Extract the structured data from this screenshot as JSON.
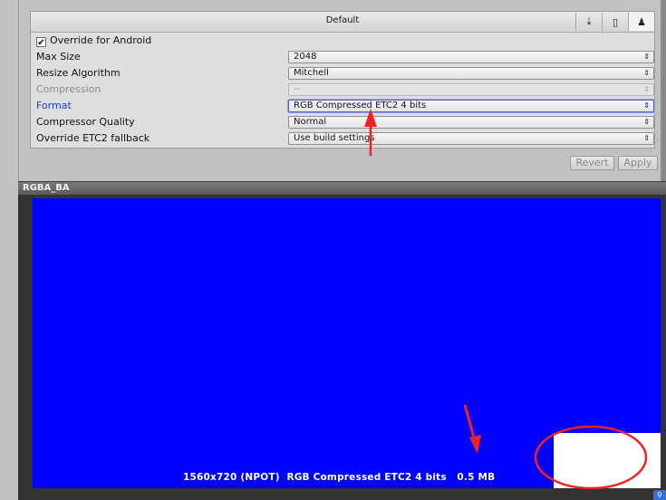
{
  "panel": {
    "header_title": "Default",
    "platform_tabs": [
      {
        "icon": "download-icon",
        "glyph": "⤓"
      },
      {
        "icon": "phone-icon",
        "glyph": "▯"
      },
      {
        "icon": "android-icon",
        "glyph": "♟"
      }
    ]
  },
  "settings": {
    "override_checked": true,
    "override_label": "Override for Android",
    "check_glyph": "✔",
    "rows": [
      {
        "label": "Max Size",
        "value": "2048",
        "state": "normal"
      },
      {
        "label": "Resize Algorithm",
        "value": "Mitchell",
        "state": "normal"
      },
      {
        "label": "Compression",
        "value": "--",
        "state": "disabled"
      },
      {
        "label": "Format",
        "value": "RGB Compressed ETC2 4 bits",
        "state": "focused"
      },
      {
        "label": "Compressor Quality",
        "value": "Normal",
        "state": "normal"
      },
      {
        "label": "Override ETC2 fallback",
        "value": "Use build settings",
        "state": "normal"
      }
    ],
    "dropdown_arrow": "⇕"
  },
  "buttons": {
    "revert": "Revert",
    "apply": "Apply"
  },
  "preview": {
    "asset_name": "RGBA_BA",
    "texture_color": "#0000ff",
    "info": "1560x720 (NPOT)  RGB Compressed ETC2 4 bits   0.5 MB"
  },
  "annotation_color": "#ee2222"
}
